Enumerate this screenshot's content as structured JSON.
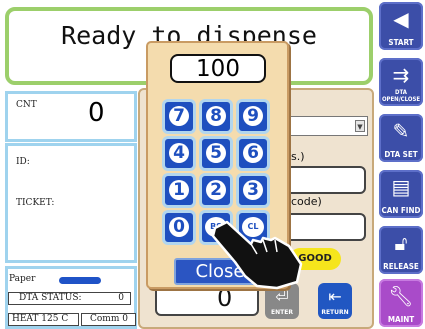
{
  "status": {
    "message": "Ready to dispense"
  },
  "counter": {
    "label": "CNT",
    "value": "0"
  },
  "info": {
    "id_label": "ID:",
    "ticket_label": "TICKET:"
  },
  "bottom": {
    "paper_label": "Paper",
    "dta_status_label": "DTA STATUS:",
    "dta_status_value": "0",
    "heat": "HEAT 125  C",
    "comm": "Comm 0"
  },
  "background_dialog": {
    "fragment_1": "s.)",
    "fragment_2": "code)",
    "good_badge": "GOOD",
    "quantity_value": "0",
    "enter_label": "ENTER",
    "return_label": "RETURN"
  },
  "keypad": {
    "display_value": "100",
    "keys": [
      "7",
      "8",
      "9",
      "4",
      "5",
      "6",
      "1",
      "2",
      "3",
      "0",
      "BS",
      "CL"
    ],
    "close_label": "Close"
  },
  "sidebar": {
    "buttons": [
      {
        "label": "START",
        "icon": "play-left-icon"
      },
      {
        "label": "DTA OPEN/CLOSE",
        "icon": "dta-open-close-icon"
      },
      {
        "label": "DTA SET",
        "icon": "dta-set-icon"
      },
      {
        "label": "CAN FIND",
        "icon": "can-find-icon"
      },
      {
        "label": "RELEASE",
        "icon": "unlock-icon"
      },
      {
        "label": "MAINT",
        "icon": "wrench-icon"
      }
    ],
    "colors": {
      "primary": "#3c4ea8",
      "maint": "#a94bc9"
    }
  },
  "colors": {
    "status_border": "#9ccf6b",
    "panel_border": "#9fd3ee",
    "keypad_bg": "#f4dcae",
    "key_blue": "#1e4fbf",
    "good_yellow": "#f5e51c"
  }
}
